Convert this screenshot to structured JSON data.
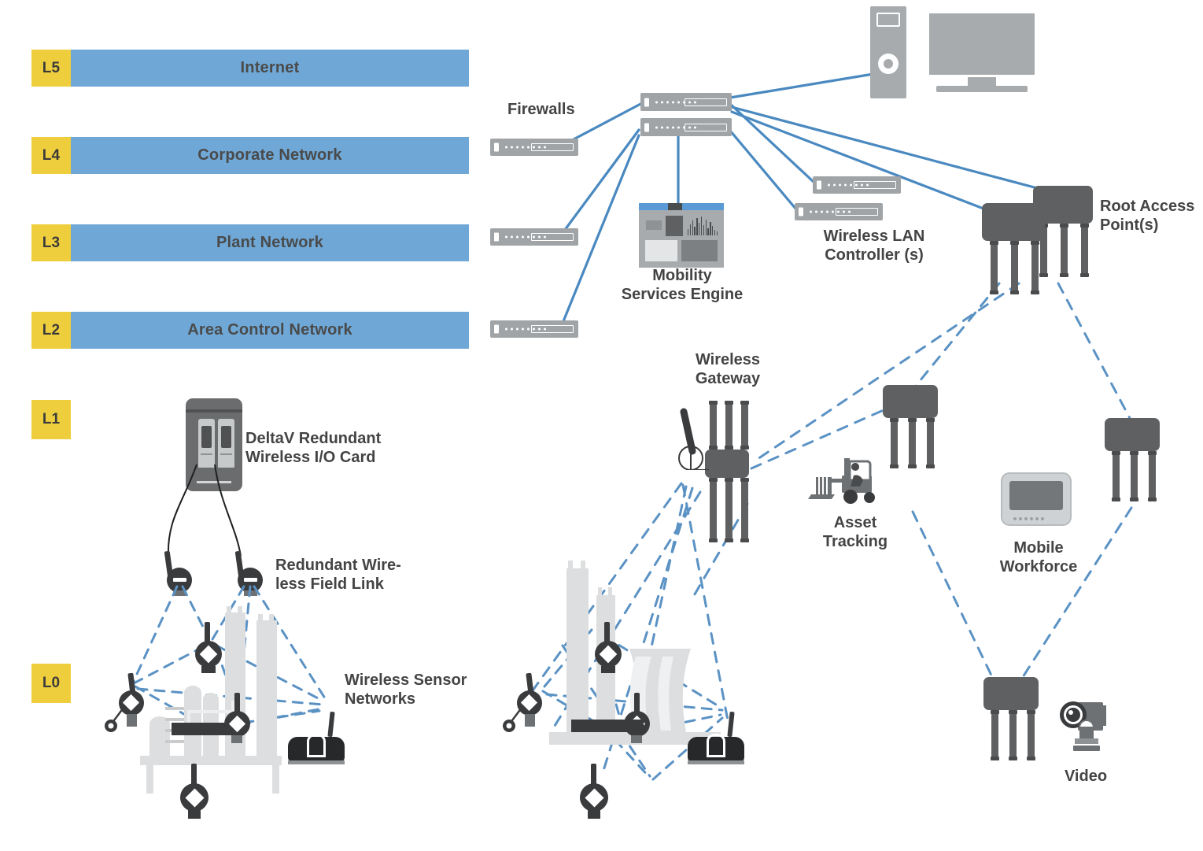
{
  "layers": [
    {
      "tag": "L5",
      "name": "Internet"
    },
    {
      "tag": "L4",
      "name": "Corporate Network"
    },
    {
      "tag": "L3",
      "name": "Plant Network"
    },
    {
      "tag": "L2",
      "name": "Area Control Network"
    }
  ],
  "layer_tags_solo": [
    {
      "tag": "L1"
    },
    {
      "tag": "L0"
    }
  ],
  "labels": {
    "firewalls": "Firewalls",
    "mobility_services_engine": "Mobility\nServices Engine",
    "wireless_lan_controller": "Wireless LAN\nController (s)",
    "root_access_point": "Root Access\nPoint(s)",
    "wireless_gateway": "Wireless\nGateway",
    "asset_tracking": "Asset\nTracking",
    "mobile_workforce": "Mobile\nWorkforce",
    "video": "Video",
    "deltav_io_card": "DeltaV Redundant\nWireless I/O Card",
    "redundant_field_link": "Redundant Wire-\nless Field Link",
    "wireless_sensor_networks": "Wireless Sensor\nNetworks"
  },
  "colors": {
    "layer_tag_bg": "#EECE3D",
    "layer_bar_bg": "#6FA8D6",
    "label_text": "#444444",
    "wired_link": "#4A89C0",
    "wireless_link": "#5B92C4",
    "device_dark": "#5F6062",
    "device_light": "#A0A4A6",
    "plant_silhouette": "#D9DBDC"
  },
  "icons": {
    "switch": "network-switch-icon",
    "firewall": "firewall-appliance-icon",
    "access_point": "wireless-access-point-icon",
    "server": "mobility-services-engine-icon",
    "workstation": "desktop-computer-icon",
    "tablet": "rugged-tablet-icon",
    "forklift": "forklift-icon",
    "camera": "ptz-camera-icon",
    "io_card": "deltav-io-card-icon",
    "transmitter": "wireless-field-transmitter-icon"
  }
}
